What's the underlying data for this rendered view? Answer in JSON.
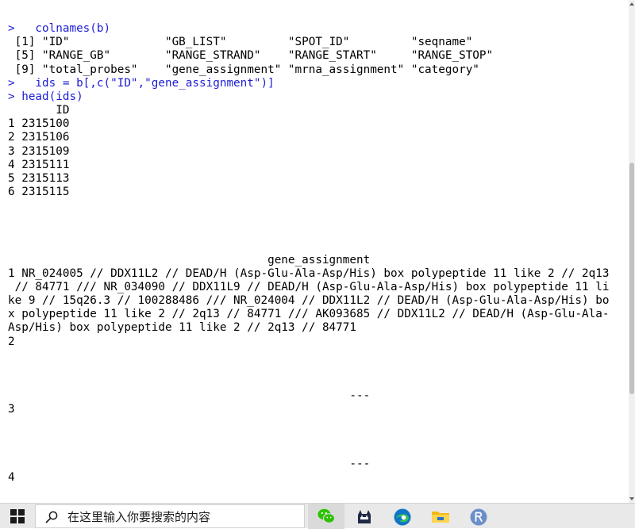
{
  "console": {
    "lines": [
      "",
      ">   colnames(b)",
      " [1] \"ID\"              \"GB_LIST\"         \"SPOT_ID\"         \"seqname\"",
      " [5] \"RANGE_GB\"        \"RANGE_STRAND\"    \"RANGE_START\"     \"RANGE_STOP\"",
      " [9] \"total_probes\"    \"gene_assignment\" \"mrna_assignment\" \"category\"",
      ">   ids = b[,c(\"ID\",\"gene_assignment\")]",
      "> head(ids)",
      "       ID",
      "1 2315100",
      "2 2315106",
      "3 2315109",
      "4 2315111",
      "5 2315113",
      "6 2315115",
      "",
      "",
      "",
      "",
      "                                      gene_assignment",
      "1 NR_024005 // DDX11L2 // DEAD/H (Asp-Glu-Ala-Asp/His) box polypeptide 11 like 2 // 2q13",
      " // 84771 /// NR_034090 // DDX11L9 // DEAD/H (Asp-Glu-Ala-Asp/His) box polypeptide 11 li",
      "ke 9 // 15q26.3 // 100288486 /// NR_024004 // DDX11L2 // DEAD/H (Asp-Glu-Ala-Asp/His) bo",
      "x polypeptide 11 like 2 // 2q13 // 84771 /// AK093685 // DDX11L2 // DEAD/H (Asp-Glu-Ala-",
      "Asp/His) box polypeptide 11 like 2 // 2q13 // 84771",
      "2",
      "",
      "",
      "",
      "                                                  ---",
      "3",
      "",
      "",
      "",
      "                                                  ---",
      "4"
    ],
    "command_line_indices": [
      1,
      5,
      6
    ],
    "command_color": "#1d1dd6",
    "output_color": "#000000"
  },
  "taskbar": {
    "search_placeholder": "在这里输入你要搜索的内容",
    "apps": [
      "windows-start-icon",
      "wechat-icon",
      "qq-icon",
      "edge-icon",
      "file-explorer-icon",
      "r-icon"
    ]
  }
}
